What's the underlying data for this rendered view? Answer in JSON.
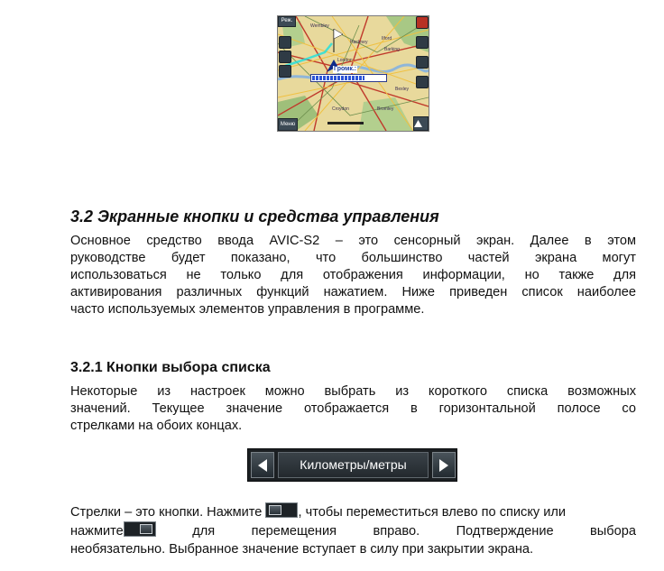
{
  "map": {
    "mode_label": "Реж.",
    "menu_label": "Меню",
    "volume_label": "Громк.:",
    "volume_level": 0.72,
    "place_labels": [
      "London",
      "Hackney",
      "Ilford",
      "Barking",
      "Bromley",
      "Wembley",
      "Croydon",
      "Bexley"
    ]
  },
  "section": {
    "heading": "3.2  Экранные кнопки и средства управления",
    "paragraph_lines": [
      "Основное средство ввода AVIC-S2 – это сенсорный экран. Далее в этом",
      "руководстве будет показано, что большинство частей экрана могут",
      "использоваться не только для отображения информации, но также для",
      "активирования различных функций нажатием. Ниже приведен список наиболее",
      "часто используемых элементов управления в программе."
    ]
  },
  "subsection": {
    "heading": "3.2.1  Кнопки выбора списка",
    "paragraph_lines": [
      "Некоторые из настроек можно выбрать из короткого списка возможных",
      "значений. Текущее значение отображается в горизонтальной полосе со",
      "стрелками на обоих концах."
    ],
    "selector": {
      "value": "Километры/метры",
      "prev_icon": "triangle-left-icon",
      "next_icon": "triangle-right-icon"
    },
    "arrows_text": {
      "line1_before": "Стрелки – это кнопки. Нажмите",
      "line1_after": ", чтобы переместиться влево по списку или",
      "line2_before": "нажмите",
      "line2_after": "для перемещения вправо. Подтверждение выбора",
      "line3": "необязательно. Выбранное значение вступает в силу при закрытии экрана."
    }
  }
}
